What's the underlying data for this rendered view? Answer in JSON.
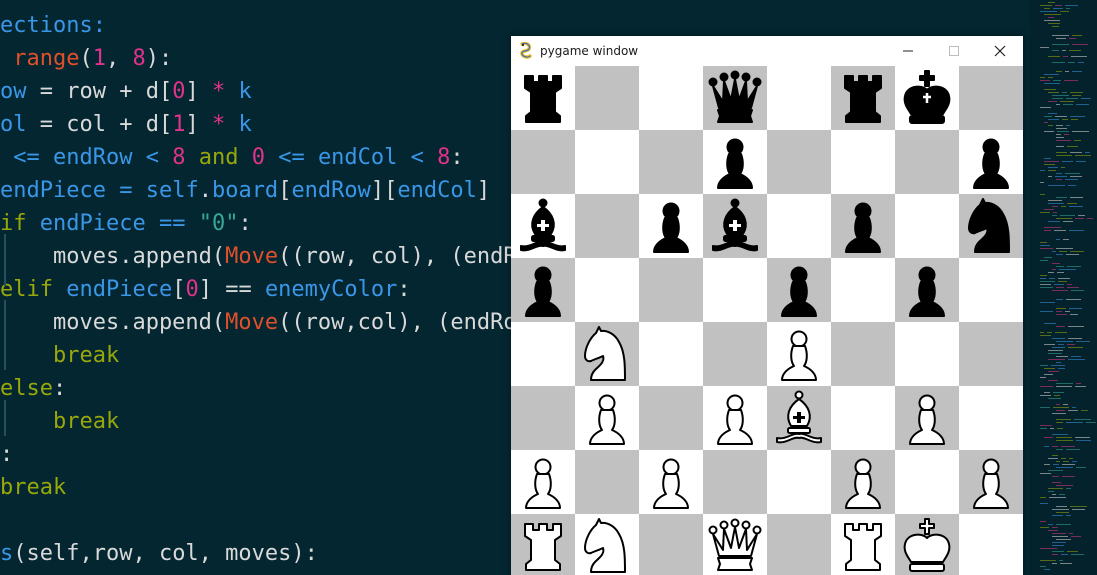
{
  "editor": {
    "lines": [
      [
        {
          "t": "ections:",
          "c": "ident"
        }
      ],
      [
        {
          "t": " range",
          "c": "func"
        },
        {
          "t": "(",
          "c": "default"
        },
        {
          "t": "1",
          "c": "number"
        },
        {
          "t": ", ",
          "c": "default"
        },
        {
          "t": "8",
          "c": "number"
        },
        {
          "t": "):",
          "c": "default"
        }
      ],
      [
        {
          "t": "ow",
          "c": "ident"
        },
        {
          "t": " = row + d[",
          "c": "default"
        },
        {
          "t": "0",
          "c": "number"
        },
        {
          "t": "] ",
          "c": "default"
        },
        {
          "t": "*",
          "c": "number"
        },
        {
          "t": " k",
          "c": "ident"
        }
      ],
      [
        {
          "t": "ol",
          "c": "ident"
        },
        {
          "t": " = col + d[",
          "c": "default"
        },
        {
          "t": "1",
          "c": "number"
        },
        {
          "t": "] ",
          "c": "default"
        },
        {
          "t": "*",
          "c": "number"
        },
        {
          "t": " k",
          "c": "ident"
        }
      ],
      [
        {
          "t": " <= ",
          "c": "ident"
        },
        {
          "t": "endRow",
          "c": "ident"
        },
        {
          "t": " < ",
          "c": "ident"
        },
        {
          "t": "8",
          "c": "number"
        },
        {
          "t": " and ",
          "c": "keyword"
        },
        {
          "t": "0",
          "c": "number"
        },
        {
          "t": " <= ",
          "c": "ident"
        },
        {
          "t": "endCol",
          "c": "ident"
        },
        {
          "t": " < ",
          "c": "ident"
        },
        {
          "t": "8",
          "c": "number"
        },
        {
          "t": ":",
          "c": "default"
        }
      ],
      [
        {
          "t": "endPiece",
          "c": "ident"
        },
        {
          "t": " = ",
          "c": "ident"
        },
        {
          "t": "self",
          "c": "ident"
        },
        {
          "t": ".",
          "c": "default"
        },
        {
          "t": "board",
          "c": "ident"
        },
        {
          "t": "[",
          "c": "default"
        },
        {
          "t": "endRow",
          "c": "ident"
        },
        {
          "t": "][",
          "c": "default"
        },
        {
          "t": "endCol",
          "c": "ident"
        },
        {
          "t": "]",
          "c": "default"
        }
      ],
      [
        {
          "t": "if ",
          "c": "keyword"
        },
        {
          "t": "endPiece",
          "c": "ident"
        },
        {
          "t": " == ",
          "c": "ident"
        },
        {
          "t": "\"0\"",
          "c": "string"
        },
        {
          "t": ":",
          "c": "default"
        }
      ],
      [
        {
          "t": "    moves.append(",
          "c": "default"
        },
        {
          "t": "Move",
          "c": "func"
        },
        {
          "t": "((row, col), (endR",
          "c": "default"
        }
      ],
      [
        {
          "t": "elif ",
          "c": "keyword"
        },
        {
          "t": "endPiece",
          "c": "ident"
        },
        {
          "t": "[",
          "c": "default"
        },
        {
          "t": "0",
          "c": "number"
        },
        {
          "t": "] == ",
          "c": "default"
        },
        {
          "t": "enemyColor",
          "c": "ident"
        },
        {
          "t": ":",
          "c": "default"
        }
      ],
      [
        {
          "t": "    moves.append(",
          "c": "default"
        },
        {
          "t": "Move",
          "c": "func"
        },
        {
          "t": "((row,col), (endRo",
          "c": "default"
        }
      ],
      [
        {
          "t": "    break",
          "c": "keyword"
        }
      ],
      [
        {
          "t": "else",
          "c": "keyword"
        },
        {
          "t": ":",
          "c": "default"
        }
      ],
      [
        {
          "t": "    break",
          "c": "keyword"
        }
      ],
      [
        {
          "t": ":",
          "c": "default"
        }
      ],
      [
        {
          "t": "break",
          "c": "keyword"
        }
      ],
      [],
      [
        {
          "t": "s",
          "c": "ident"
        },
        {
          "t": "(self,row, col, moves):",
          "c": "default"
        }
      ]
    ]
  },
  "colors": {
    "editor_bg": "#032631",
    "default": "#d9d9d9",
    "keyword": "#98a80a",
    "number": "#e0338a",
    "func": "#e0502a",
    "ident": "#3a96e6",
    "string": "#35a89a",
    "board_light": "#ffffff",
    "board_dark": "#c1c1c1"
  },
  "window": {
    "title": "pygame window",
    "icon": "pygame-snake-icon",
    "buttons": [
      "minimize-icon",
      "maximize-icon",
      "close-icon"
    ]
  },
  "board": {
    "rows": [
      [
        "bR",
        "--",
        "--",
        "bQ",
        "--",
        "bR",
        "bK",
        "--"
      ],
      [
        "--",
        "--",
        "--",
        "bp",
        "--",
        "--",
        "--",
        "bp"
      ],
      [
        "bB",
        "--",
        "bp",
        "bB",
        "--",
        "bp",
        "--",
        "bN"
      ],
      [
        "bp",
        "--",
        "--",
        "--",
        "bp",
        "--",
        "bp",
        "--"
      ],
      [
        "--",
        "wN",
        "--",
        "--",
        "wp",
        "--",
        "--",
        "--"
      ],
      [
        "--",
        "wp",
        "--",
        "wp",
        "wB",
        "--",
        "wp",
        "--"
      ],
      [
        "wp",
        "--",
        "wp",
        "--",
        "--",
        "wp",
        "--",
        "wp"
      ],
      [
        "wR",
        "wN",
        "--",
        "wQ",
        "--",
        "wR",
        "wK",
        "--"
      ]
    ]
  }
}
